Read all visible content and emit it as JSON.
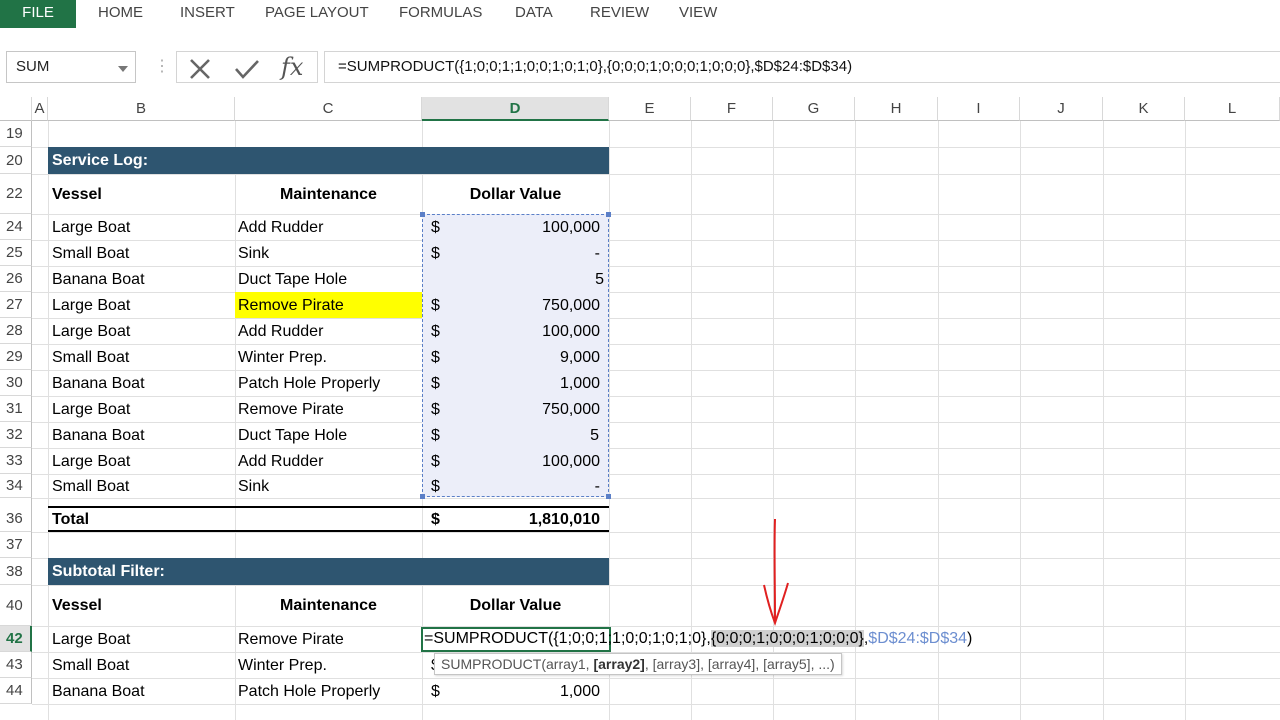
{
  "ribbon": {
    "tabs": [
      "FILE",
      "HOME",
      "INSERT",
      "PAGE LAYOUT",
      "FORMULAS",
      "DATA",
      "REVIEW",
      "VIEW"
    ]
  },
  "formula_bar": {
    "name_box": "SUM",
    "fx_label": "fx",
    "formula": "=SUMPRODUCT({1;0;0;1;1;0;0;1;0;1;0},{0;0;0;1;0;0;0;1;0;0;0},$D$24:$D$34)"
  },
  "columns": [
    "A",
    "B",
    "C",
    "D",
    "E",
    "F",
    "G",
    "H",
    "I",
    "J",
    "K",
    "L"
  ],
  "rows": [
    "19",
    "20",
    "22",
    "24",
    "25",
    "26",
    "27",
    "28",
    "29",
    "30",
    "31",
    "32",
    "33",
    "34",
    "36",
    "37",
    "38",
    "40",
    "42",
    "43",
    "44"
  ],
  "sheet": {
    "service_log_title": "Service Log:",
    "headers": {
      "vessel": "Vessel",
      "maintenance": "Maintenance",
      "dollar_value": "Dollar Value"
    },
    "log_rows": [
      {
        "vessel": "Large Boat",
        "maintenance": "Add Rudder",
        "dollar": "$",
        "value": "100,000"
      },
      {
        "vessel": "Small Boat",
        "maintenance": "Sink",
        "dollar": "$",
        "value": "-"
      },
      {
        "vessel": "Banana Boat",
        "maintenance": "Duct Tape Hole",
        "dollar": "",
        "value": "5"
      },
      {
        "vessel": "Large Boat",
        "maintenance": "Remove Pirate",
        "dollar": "$",
        "value": "750,000"
      },
      {
        "vessel": "Large Boat",
        "maintenance": "Add Rudder",
        "dollar": "$",
        "value": "100,000"
      },
      {
        "vessel": "Small Boat",
        "maintenance": "Winter Prep.",
        "dollar": "$",
        "value": "9,000"
      },
      {
        "vessel": "Banana Boat",
        "maintenance": "Patch Hole Properly",
        "dollar": "$",
        "value": "1,000"
      },
      {
        "vessel": "Large Boat",
        "maintenance": "Remove Pirate",
        "dollar": "$",
        "value": "750,000"
      },
      {
        "vessel": "Banana Boat",
        "maintenance": "Duct Tape Hole",
        "dollar": "$",
        "value": "5"
      },
      {
        "vessel": "Large Boat",
        "maintenance": "Add Rudder",
        "dollar": "$",
        "value": "100,000"
      },
      {
        "vessel": "Small Boat",
        "maintenance": "Sink",
        "dollar": "$",
        "value": "-"
      }
    ],
    "total": {
      "label": "Total",
      "dollar": "$",
      "value": "1,810,010"
    },
    "subtotal_title": "Subtotal Filter:",
    "filter_rows": [
      {
        "vessel": "Large Boat",
        "maintenance": "Remove Pirate"
      },
      {
        "vessel": "Small Boat",
        "maintenance": "Winter Prep.",
        "dollar": "$"
      },
      {
        "vessel": "Banana Boat",
        "maintenance": "Patch Hole Properly",
        "dollar": "$",
        "value": "1,000"
      }
    ],
    "edit": {
      "part1": "=SUMPRODUCT({1;0;0;1;1;0;0;1;0;1;0},",
      "part2": "{0;0;0;1;0;0;0;1;0;0;0}",
      "part3": ",",
      "part4": "$D$24:$D$34",
      "part5": ")"
    },
    "tooltip": {
      "before": "SUMPRODUCT(array1, ",
      "bold": "[array2]",
      "after": ", [array3], [array4], [array5], ...)"
    }
  },
  "colors": {
    "accent_green": "#217346",
    "header_bar": "#2e5570",
    "highlight_yellow": "#ffff00",
    "annotation_red": "#e02020"
  }
}
